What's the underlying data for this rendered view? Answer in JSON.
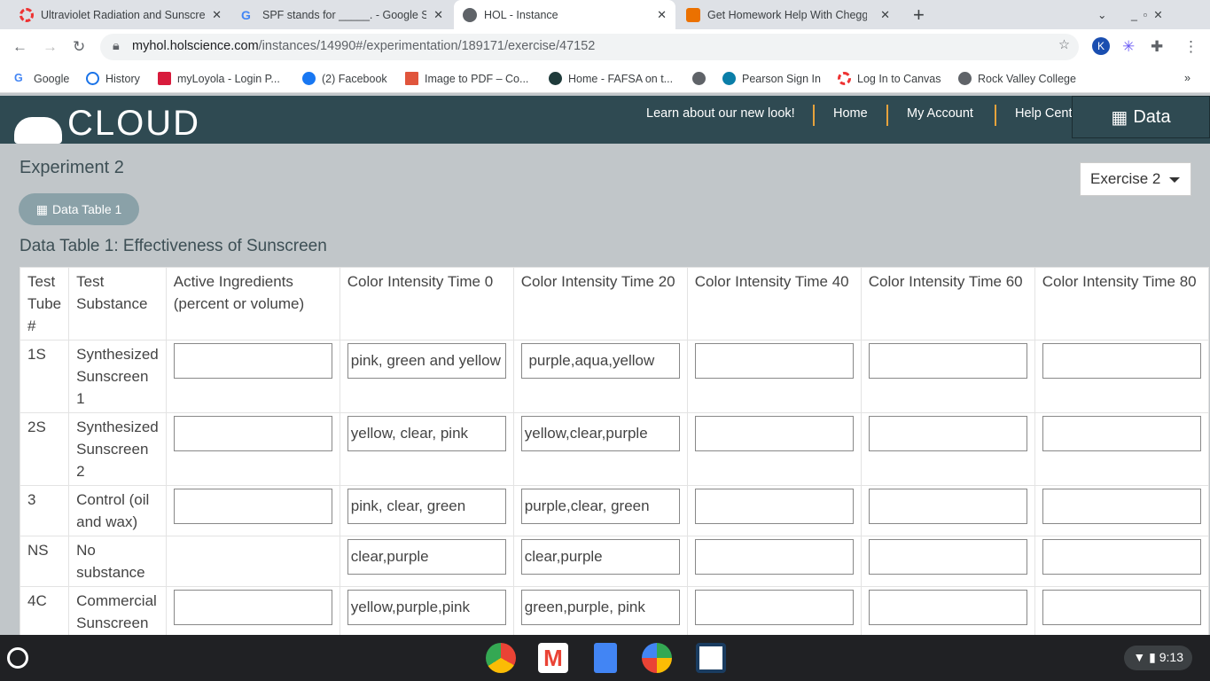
{
  "browser": {
    "tabs": [
      {
        "title": "Ultraviolet Radiation and Sunscre",
        "icon": "canvas-icon",
        "active": false
      },
      {
        "title": "SPF stands for _____. - Google Se",
        "icon": "google-icon",
        "active": false
      },
      {
        "title": "HOL - Instance",
        "icon": "globe-icon",
        "active": true
      },
      {
        "title": "Get Homework Help With Chegg",
        "icon": "chegg-icon",
        "active": false
      }
    ],
    "url_host": "myhol.holscience.com",
    "url_path": "/instances/14990#/experimentation/189171/exercise/47152",
    "bookmarks": [
      "Google",
      "History",
      "myLoyola - Login P...",
      "(2) Facebook",
      "Image to PDF – Co...",
      "Home - FAFSA on t...",
      "",
      "Pearson Sign In",
      "Log In to Canvas",
      "Rock Valley College"
    ],
    "more": "»"
  },
  "header": {
    "logo": "CLOUD",
    "links": [
      "Learn about our new look!",
      "Home",
      "My Account",
      "Help Cent"
    ],
    "data_button": "Data"
  },
  "page": {
    "title": "Experiment 2",
    "pill": "Data Table 1",
    "exercise_select": "Exercise 2",
    "table_title": "Data Table 1: Effectiveness of Sunscreen",
    "columns": [
      "Test Tube #",
      "Test Substance",
      "Active Ingredients (percent or volume)",
      "Color Intensity Time 0",
      "Color Intensity Time 20",
      "Color Intensity Time 40",
      "Color Intensity Time 60",
      "Color Intensity Time 80"
    ],
    "rows": [
      {
        "tube": "1S",
        "substance": "Synthesized Sunscreen 1",
        "values": [
          "",
          "pink, green and yellow",
          " purple,aqua,yellow",
          "",
          "",
          ""
        ]
      },
      {
        "tube": "2S",
        "substance": "Synthesized Sunscreen 2",
        "values": [
          "",
          "yellow, clear, pink",
          "yellow,clear,purple",
          "",
          "",
          ""
        ]
      },
      {
        "tube": "3",
        "substance": "Control (oil and wax)",
        "values": [
          "",
          "pink, clear, green",
          "purple,clear, green",
          "",
          "",
          ""
        ]
      },
      {
        "tube": "NS",
        "substance": "No substance",
        "values": [
          null,
          "clear,purple",
          "clear,purple",
          "",
          "",
          ""
        ]
      },
      {
        "tube": "4C",
        "substance": "Commercial Sunscreen",
        "values": [
          "",
          "yellow,purple,pink",
          "green,purple, pink",
          "",
          "",
          ""
        ]
      }
    ]
  },
  "shelf": {
    "time": "9:13"
  },
  "colors": {
    "header": "#2f4a52",
    "content_bg": "#c1c6c9",
    "accent": "#e7a33c"
  }
}
